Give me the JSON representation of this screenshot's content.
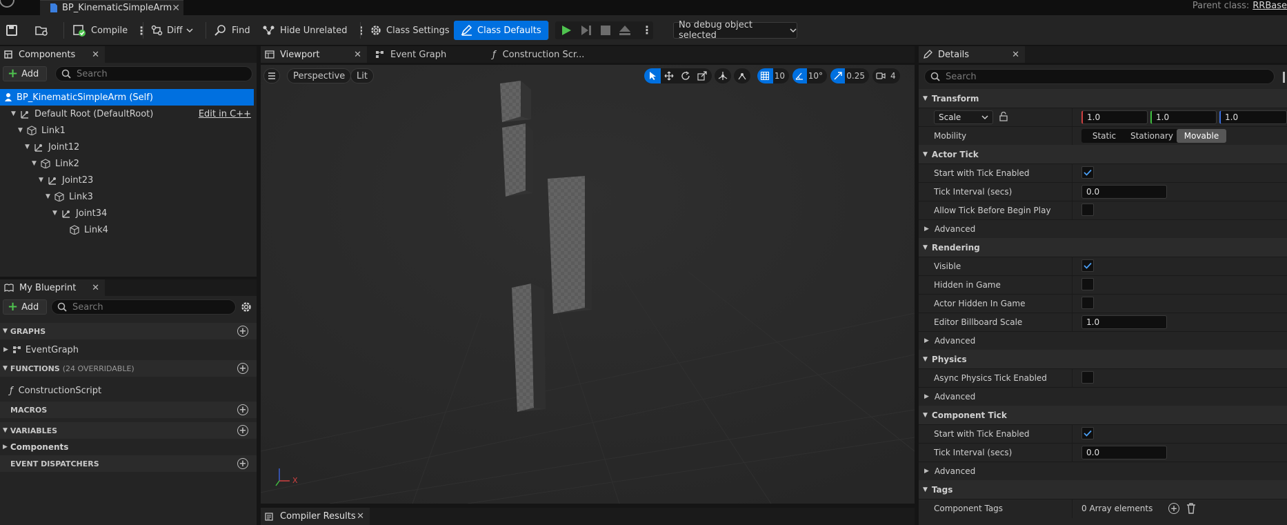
{
  "titlebar": {
    "doc_tab": "BP_KinematicSimpleArm",
    "parent_label": "Parent class:",
    "parent_value": "RRBase"
  },
  "toolbar": {
    "compile": "Compile",
    "diff": "Diff",
    "find": "Find",
    "hide_unrelated": "Hide Unrelated",
    "class_settings": "Class Settings",
    "class_defaults": "Class Defaults",
    "debug_object": "No debug object selected"
  },
  "components": {
    "tab": "Components",
    "add": "Add",
    "search_placeholder": "Search",
    "self": "BP_KinematicSimpleArm (Self)",
    "root": "Default Root (DefaultRoot)",
    "edit_cpp": "Edit in C++",
    "items": [
      "Link1",
      "Joint12",
      "Link2",
      "Joint23",
      "Link3",
      "Joint34",
      "Link4"
    ]
  },
  "my_blueprint": {
    "tab": "My Blueprint",
    "add": "Add",
    "search_placeholder": "Search",
    "graphs": "GRAPHS",
    "event_graph": "EventGraph",
    "functions": "FUNCTIONS",
    "functions_count": "(24 OVERRIDABLE)",
    "construction_script": "ConstructionScript",
    "macros": "MACROS",
    "variables": "VARIABLES",
    "components_cat": "Components",
    "event_dispatchers": "EVENT DISPATCHERS"
  },
  "center_tabs": {
    "viewport": "Viewport",
    "event_graph": "Event Graph",
    "construction": "Construction Scr..."
  },
  "viewport": {
    "perspective": "Perspective",
    "lit": "Lit",
    "grid_snap": "10",
    "rot_snap": "10°",
    "scale_snap": "0.25",
    "cam_speed": "4",
    "axis_x": "X"
  },
  "compiler": {
    "tab": "Compiler Results"
  },
  "details": {
    "tab": "Details",
    "search_placeholder": "Search",
    "transform": "Transform",
    "scale_mode": "Scale",
    "scale_x": "1.0",
    "scale_y": "1.0",
    "scale_z": "1.0",
    "mobility": "Mobility",
    "mob_static": "Static",
    "mob_stationary": "Stationary",
    "mob_movable": "Movable",
    "actor_tick": "Actor Tick",
    "start_tick": "Start with Tick Enabled",
    "tick_interval": "Tick Interval (secs)",
    "tick_interval_val": "0.0",
    "allow_tick": "Allow Tick Before Begin Play",
    "advanced": "Advanced",
    "rendering": "Rendering",
    "visible": "Visible",
    "hidden_in_game": "Hidden in Game",
    "actor_hidden": "Actor Hidden In Game",
    "billboard_scale": "Editor Billboard Scale",
    "billboard_val": "1.0",
    "physics": "Physics",
    "async_physics": "Async Physics Tick Enabled",
    "component_tick": "Component Tick",
    "comp_start_tick": "Start with Tick Enabled",
    "comp_tick_interval": "Tick Interval (secs)",
    "comp_tick_val": "0.0",
    "tags": "Tags",
    "component_tags": "Component Tags",
    "array_elements": "0 Array elements"
  },
  "colors": {
    "accent": "#0070e0",
    "play_green": "#4fc34f",
    "add_green": "#4fc34f"
  }
}
